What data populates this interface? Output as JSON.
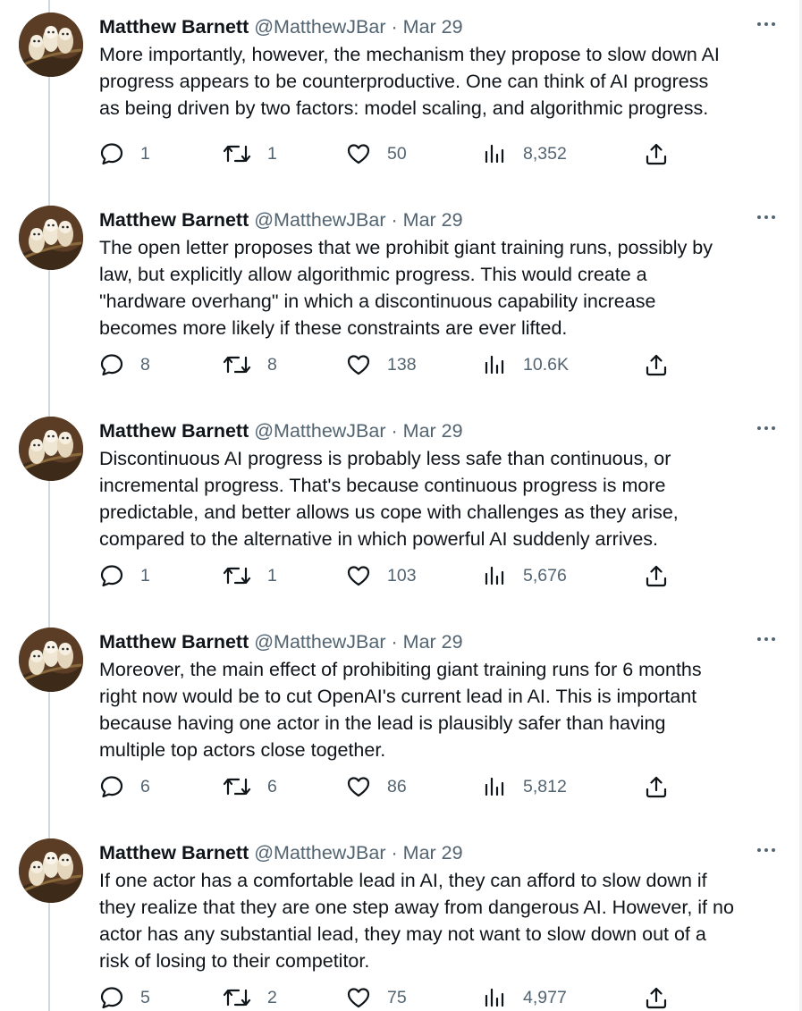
{
  "tweets": [
    {
      "name": "Matthew Barnett",
      "handle": "@MatthewJBar",
      "separator": "·",
      "date": "Mar 29",
      "lines": [
        "More importantly, however, the mechanism they propose to slow down AI",
        "progress appears to be counterproductive. One can think of AI progress",
        "as being driven by two factors: model scaling, and algorithmic progress."
      ],
      "replies": "1",
      "retweets": "1",
      "likes": "50",
      "views": "8,352"
    },
    {
      "name": "Matthew Barnett",
      "handle": "@MatthewJBar",
      "separator": "·",
      "date": "Mar 29",
      "lines": [
        "The open letter proposes that we prohibit giant training runs, possibly by",
        "law, but explicitly allow algorithmic progress. This would create a",
        "\"hardware overhang\" in which a discontinuous capability increase",
        "becomes more likely if these constraints are ever lifted."
      ],
      "replies": "8",
      "retweets": "8",
      "likes": "138",
      "views": "10.6K"
    },
    {
      "name": "Matthew Barnett",
      "handle": "@MatthewJBar",
      "separator": "·",
      "date": "Mar 29",
      "lines": [
        "Discontinuous AI progress is probably less safe than continuous, or",
        "incremental progress. That's because continuous progress is more",
        "predictable, and better allows us cope with challenges as they arise,",
        "compared to the alternative in which powerful AI suddenly arrives."
      ],
      "replies": "1",
      "retweets": "1",
      "likes": "103",
      "views": "5,676"
    },
    {
      "name": "Matthew Barnett",
      "handle": "@MatthewJBar",
      "separator": "·",
      "date": "Mar 29",
      "lines": [
        "Moreover, the main effect of prohibiting giant training runs for 6 months",
        "right now would be to cut OpenAI's current lead in AI. This is important",
        "because having one actor in the lead is plausibly safer than having",
        "multiple top actors close together."
      ],
      "replies": "6",
      "retweets": "6",
      "likes": "86",
      "views": "5,812"
    },
    {
      "name": "Matthew Barnett",
      "handle": "@MatthewJBar",
      "separator": "·",
      "date": "Mar 29",
      "lines": [
        "If one actor has a comfortable lead in AI, they can afford to slow down if",
        "they realize that they are one step away from dangerous AI. However, if no",
        "actor has any substantial lead, they may not want to slow down out of a",
        "risk of losing to their competitor."
      ],
      "replies": "5",
      "retweets": "2",
      "likes": "75",
      "views": "4,977"
    }
  ],
  "icons": {
    "reply": "speech-bubble",
    "retweet": "retweet-arrows",
    "like": "heart-outline",
    "views": "bar-chart",
    "share": "upload-arrow",
    "more": "three-dots"
  },
  "colors": {
    "text": "#0f1419",
    "secondary": "#536471",
    "thread_line": "#cfd9de"
  }
}
